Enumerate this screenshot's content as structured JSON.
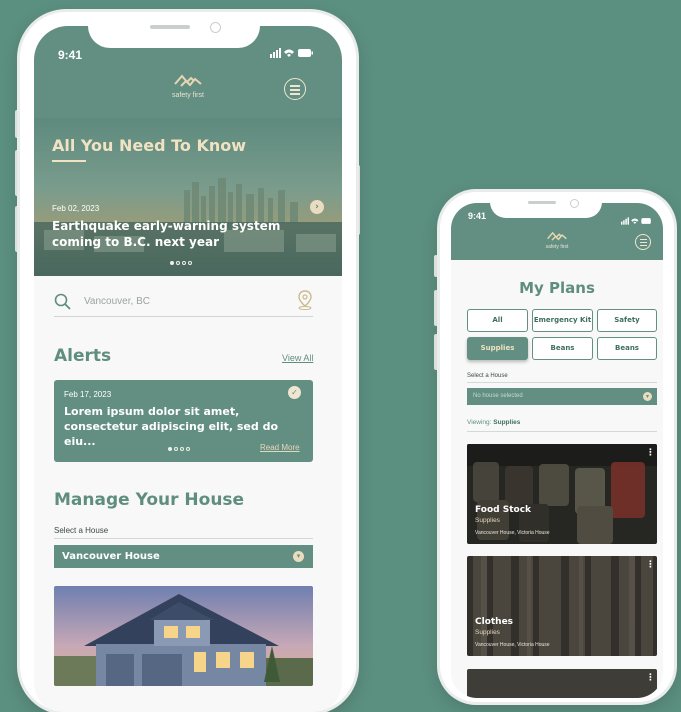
{
  "phone_main": {
    "status": {
      "time": "9:41",
      "icons": "signal-wifi-battery"
    },
    "brand": {
      "name": "safety first",
      "logo_icon": "mountain-logo-icon"
    },
    "hero": {
      "title": "All You Need To Know",
      "date": "Feb 02, 2023",
      "headline_line1": "Earthquake early-warning system",
      "headline_line2": "coming to B.C. next year",
      "pager_total": 4,
      "pager_active": 1
    },
    "search": {
      "placeholder": "Vancouver, BC"
    },
    "alerts": {
      "title": "Alerts",
      "view_all": "View All",
      "card": {
        "date": "Feb 17, 2023",
        "line1": "Lorem ipsum dolor sit amet,",
        "line2": "consectetur adipiscing elit, sed do eiu...",
        "read_more": "Read More"
      }
    },
    "manage": {
      "title": "Manage Your House",
      "select_label": "Select a House",
      "selected_house": "Vancouver House"
    }
  },
  "phone_plans": {
    "status": {
      "time": "9:41"
    },
    "brand": {
      "name": "safety first"
    },
    "title": "My Plans",
    "filters": [
      {
        "label": "All",
        "active": false
      },
      {
        "label": "Emergency Kit",
        "active": false
      },
      {
        "label": "Safety",
        "active": false
      },
      {
        "label": "Supplies",
        "active": true
      },
      {
        "label": "Beans",
        "active": false
      },
      {
        "label": "Beans",
        "active": false
      }
    ],
    "select_label": "Select a House",
    "select_placeholder": "No house selected",
    "viewing_prefix": "Viewing:",
    "viewing_value": "Supplies",
    "cards": [
      {
        "title": "Food Stock",
        "category": "Supplies",
        "houses": "Vancouver House, Victoria House"
      },
      {
        "title": "Clothes",
        "category": "Supplies",
        "houses": "Vancouver House, Victoria House"
      }
    ]
  },
  "colors": {
    "background": "#5b8f7f",
    "primary": "#628f81",
    "accent": "#f0e2c3",
    "heading": "#5f8e7f"
  }
}
